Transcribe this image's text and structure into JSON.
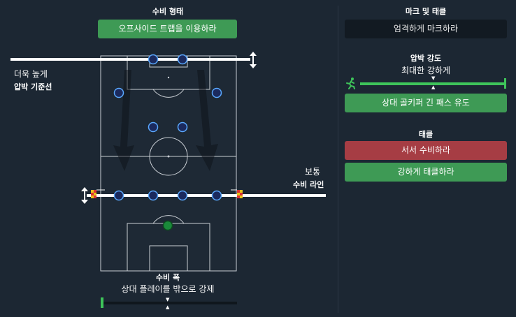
{
  "defense_shape": {
    "title": "수비 형태",
    "option_label": "오프사이드 트랩을 이용하라"
  },
  "line_of_engagement": {
    "label_line1": "더욱 높게",
    "label_line2": "압박 기준선"
  },
  "defensive_line": {
    "label_line1": "보통",
    "label_line2": "수비 라인"
  },
  "defensive_width": {
    "title": "수비 폭",
    "value_label": "상대 플레이를 밖으로 강제",
    "level": 0.5
  },
  "marking_tackling": {
    "title": "마크 및 태클",
    "marking_label": "엄격하게 마크하라"
  },
  "pressing_intensity": {
    "title": "압박 강도",
    "value_label": "최대한 강하게",
    "level": 1.0,
    "option_label": "상대 골키퍼 긴 패스 유도"
  },
  "tackling": {
    "title": "태클",
    "option_stay": "서서 수비하라",
    "option_hard": "강하게 태클하라"
  },
  "colors": {
    "accent_green": "#3e9a55",
    "red": "#a63d44",
    "player_blue": "#1b2a5e",
    "goalkeeper_green": "#1a8a3a"
  }
}
